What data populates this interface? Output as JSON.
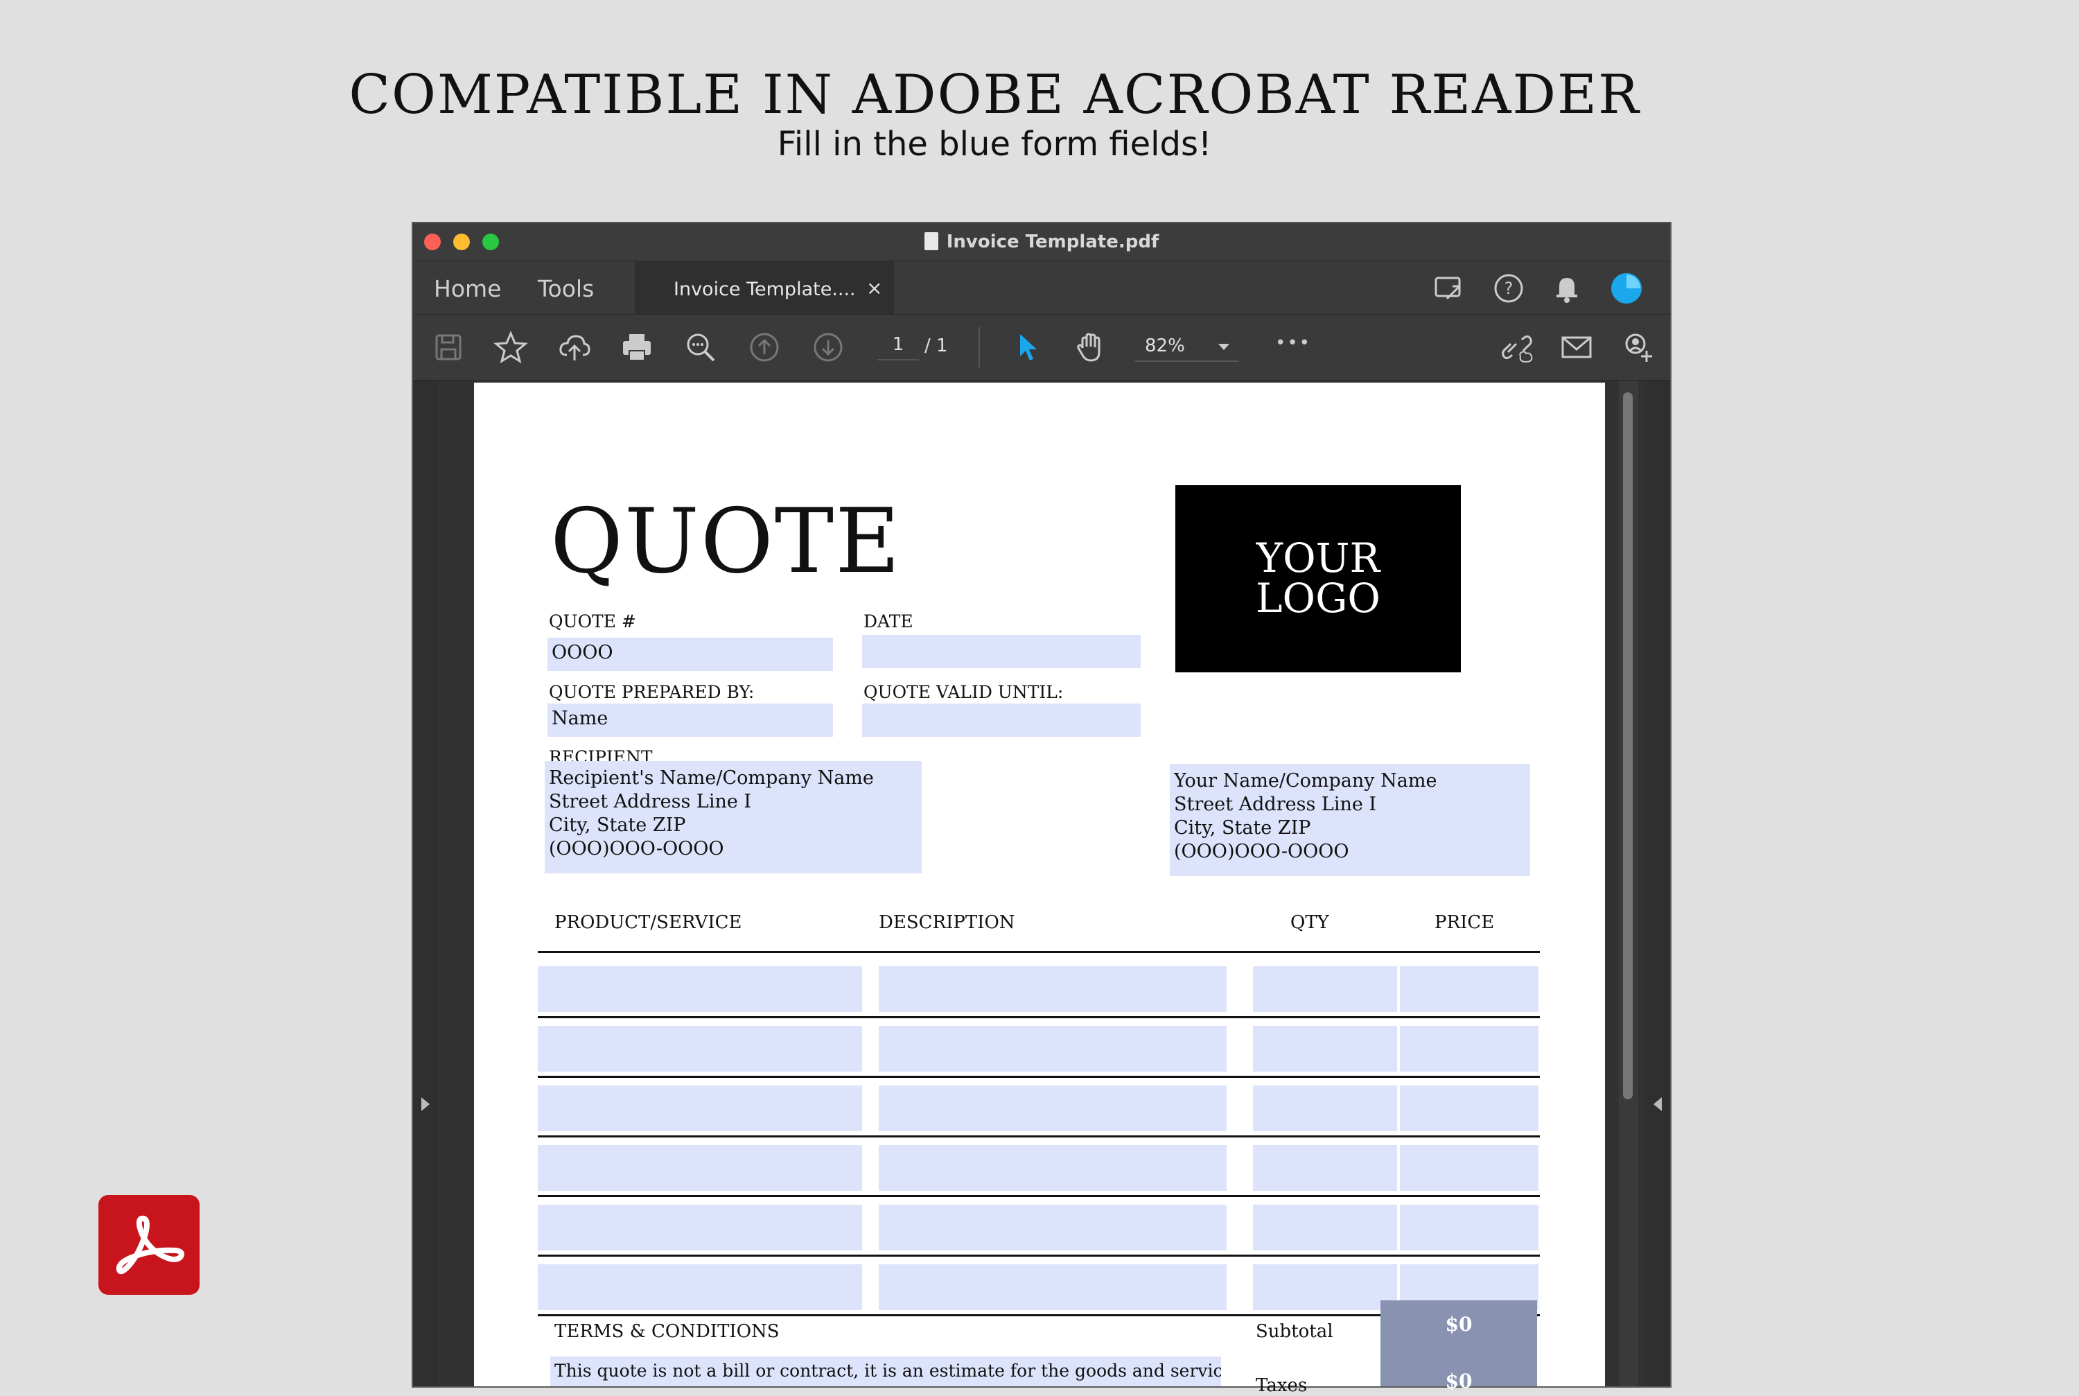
{
  "banner": {
    "headline": "COMPATIBLE IN ADOBE ACROBAT READER",
    "subline": "Fill in the blue form fields!"
  },
  "window": {
    "title": "Invoice Template.pdf",
    "nav": {
      "home": "Home",
      "tools": "Tools",
      "tab_label": "Invoice Template....",
      "tab_close": "×"
    },
    "toolbar": {
      "page_current": "1",
      "page_total": "/ 1",
      "zoom": "82%",
      "more": "•••"
    },
    "accent_color": "#1aa7ec"
  },
  "document": {
    "title": "QUOTE",
    "logo": {
      "line1": "YOUR",
      "line2": "LOGO"
    },
    "fields": {
      "quote_number_label": "QUOTE #",
      "quote_number_value": "OOOO",
      "date_label": "DATE",
      "date_value": "",
      "prepared_by_label": "QUOTE PREPARED BY:",
      "prepared_by_value": "Name",
      "valid_until_label": "QUOTE VALID UNTIL:",
      "valid_until_value": ""
    },
    "recipient": {
      "label": "RECIPIENT",
      "lines": [
        "Recipient's Name/Company Name",
        "Street Address Line I",
        "City, State ZIP",
        "(OOO)OOO-OOOO"
      ]
    },
    "sender": {
      "lines": [
        "Your Name/Company Name",
        "Street Address Line I",
        "City, State ZIP",
        "(OOO)OOO-OOOO"
      ]
    },
    "table": {
      "headers": [
        "PRODUCT/SERVICE",
        "DESCRIPTION",
        "QTY",
        "PRICE"
      ],
      "row_count": 6
    },
    "terms": {
      "label": "TERMS & CONDITIONS",
      "text": "This quote is not a bill or contract, it is an estimate for the goods and services"
    },
    "summary": {
      "subtotal_label": "Subtotal",
      "subtotal_value": "$0",
      "taxes_label": "Taxes",
      "taxes_value": "$0"
    },
    "field_color": "#dde3fb"
  }
}
